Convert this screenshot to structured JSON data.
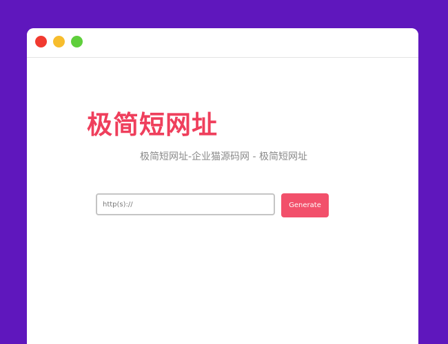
{
  "page": {
    "background_color": "#5f17bd",
    "accent_color": "#ef3f5c"
  },
  "window": {
    "controls": [
      {
        "name": "close",
        "color": "#f13a30"
      },
      {
        "name": "minimize",
        "color": "#f7bd2d"
      },
      {
        "name": "maximize",
        "color": "#5fcf3c"
      }
    ]
  },
  "header": {
    "title": "极简短网址",
    "subtitle": "极简短网址-企业猫源码网 - 极简短网址"
  },
  "form": {
    "url_placeholder": "http(s)://",
    "url_value": "",
    "generate_label": "Generate"
  }
}
